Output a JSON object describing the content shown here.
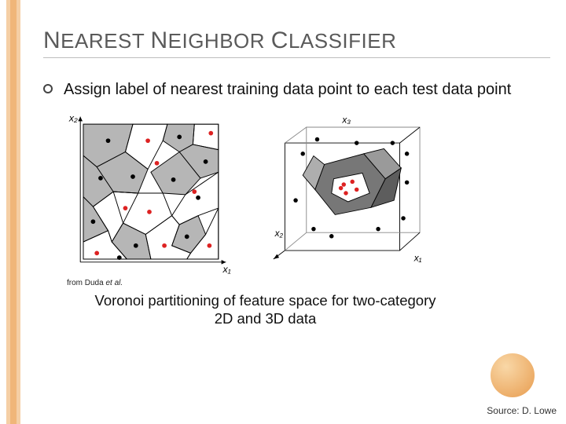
{
  "title_parts": {
    "n1": "N",
    "t1": "EAREST ",
    "n2": "N",
    "t2": "EIGHBOR ",
    "n3": "C",
    "t3": "LASSIFIER"
  },
  "bullet": "Assign label of nearest training data point to each test data point",
  "figure_credit_prefix": "from Duda ",
  "figure_credit_em": "et al.",
  "caption": "Voronoi partitioning of feature space for two-category 2D and 3D data",
  "source": "Source: D. Lowe",
  "axes": {
    "x1": "x₁",
    "x2": "x₂",
    "x3": "x₃"
  }
}
